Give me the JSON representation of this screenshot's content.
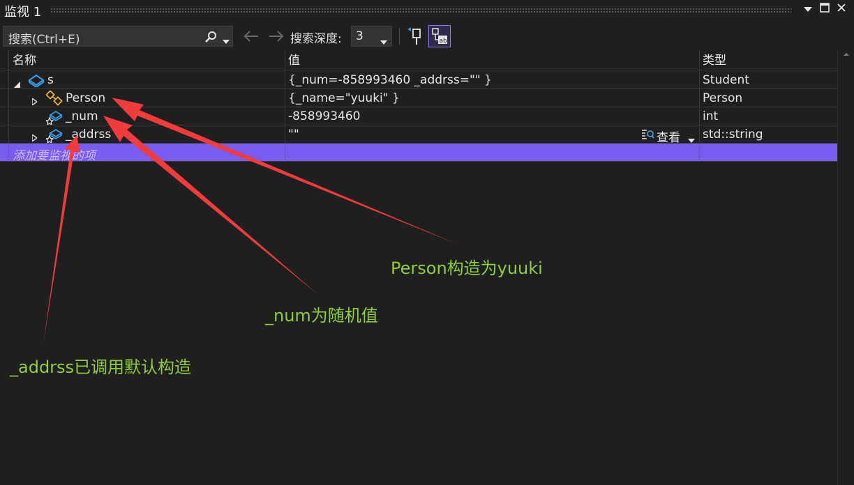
{
  "window": {
    "title": "监视 1"
  },
  "toolbar": {
    "search_text": "搜索(Ctrl+E)",
    "depth_label": "搜索深度:",
    "depth_value": "3"
  },
  "columns": {
    "name": "名称",
    "value": "值",
    "type": "类型"
  },
  "rows": [
    {
      "name": "s",
      "value": "{_num=-858993460 _addrss=\"\" }",
      "type": "Student",
      "icon": "class-object-icon",
      "expanded": true
    },
    {
      "name": "Person",
      "value": "{_name=\"yuuki\" }",
      "type": "Person",
      "icon": "base-class-icon",
      "expanded": false
    },
    {
      "name": "_num",
      "value": "-858993460",
      "type": "int",
      "icon": "field-icon"
    },
    {
      "name": "_addrss",
      "value": "\"\"",
      "type": "std::string",
      "icon": "field-icon",
      "expanded": false,
      "visualizer": "查看"
    }
  ],
  "add_item": "添加要监视的项",
  "annotations": {
    "person": "Person构造为yuuki",
    "num": "_num为随机值",
    "addrss": "_addrss已调用默认构造"
  },
  "colors": {
    "accent": "#7a5cf0",
    "annotation": "#8fce3c",
    "arrow": "#f03c3c"
  }
}
